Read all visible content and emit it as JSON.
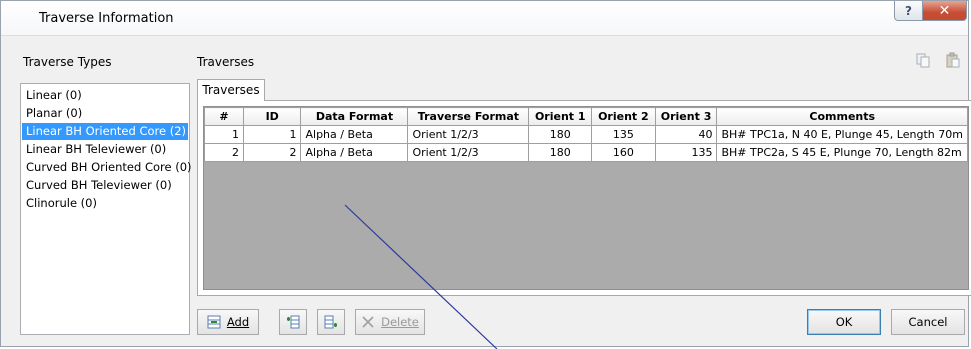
{
  "window": {
    "title": "Traverse Information",
    "help_label": "?",
    "close_label": "✕"
  },
  "left": {
    "label": "Traverse Types",
    "items": [
      {
        "label": "Linear (0)"
      },
      {
        "label": "Planar (0)"
      },
      {
        "label": "Linear BH Oriented Core (2)",
        "selected": true
      },
      {
        "label": "Linear BH Televiewer (0)"
      },
      {
        "label": "Curved BH Oriented Core (0)"
      },
      {
        "label": "Curved BH Televiewer (0)"
      },
      {
        "label": "Clinorule (0)"
      }
    ]
  },
  "right": {
    "label": "Traverses",
    "tab_label": "Traverses"
  },
  "table": {
    "headers": [
      "#",
      "ID",
      "Data Format",
      "Traverse Format",
      "Orient 1",
      "Orient 2",
      "Orient 3",
      "Comments"
    ],
    "rows": [
      [
        "1",
        "1",
        "Alpha / Beta",
        "Orient 1/2/3",
        "180",
        "135",
        "40",
        "BH# TPC1a, N 40 E, Plunge 45, Length 70m"
      ],
      [
        "2",
        "2",
        "Alpha / Beta",
        "Orient 1/2/3",
        "180",
        "160",
        "135",
        "BH# TPC2a, S 45 E, Plunge 70, Length 82m"
      ]
    ]
  },
  "buttons": {
    "add": "Add",
    "delete": "Delete",
    "ok": "OK",
    "cancel": "Cancel"
  },
  "colors": {
    "selection": "#3399ff",
    "close_button": "#c74d34",
    "annotation_line": "#2b3a9a"
  }
}
